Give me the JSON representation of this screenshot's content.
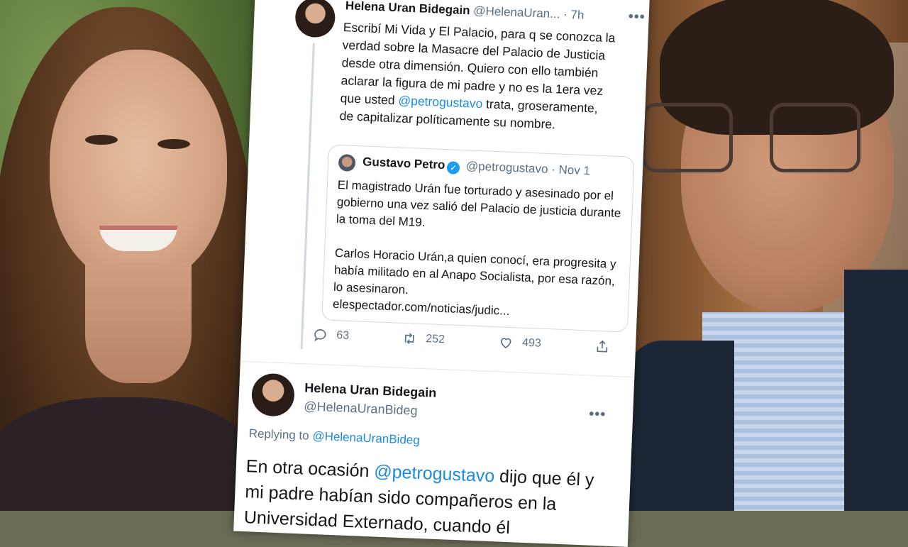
{
  "main_tweet": {
    "author_name": "Helena Uran Bidegain",
    "author_handle": "@HelenaUran...",
    "time": "· 7h",
    "text_lines": [
      "Escribí Mi Vida y El Palacio, para q se conozca la",
      "verdad sobre la Masacre del Palacio de Justicia",
      "desde otra dimensión. Quiero con ello también",
      "aclarar la figura de mi padre y no es la 1era vez",
      "que usted ",
      "@petrogustavo",
      " trata, groseramente,",
      "de capitalizar políticamente su nombre."
    ],
    "more": "•••"
  },
  "quoted_tweet": {
    "author_name": "Gustavo Petro",
    "author_handle": "@petrogustavo · Nov 1",
    "verified_mark": "✓",
    "paragraph_1": "El magistrado Urán fue torturado y asesinado por el gobierno una vez salió del Palacio de justicia durante la toma del M19.",
    "paragraph_2": "Carlos Horacio Urán,a quien conocí, era progresita y había militado en al Anapo Socialista, por esa razón, lo asesinaron.",
    "link": "elespectador.com/noticias/judic..."
  },
  "actions": {
    "replies": "63",
    "retweets": "252",
    "likes": "493"
  },
  "reply_tweet": {
    "author_name": "Helena Uran Bidegain",
    "author_handle": "@HelenaUranBideg",
    "more": "•••",
    "replying_label": "Replying to ",
    "replying_handle": "@HelenaUranBideg",
    "text_before": "En otra ocasión ",
    "text_mention": "@petrogustavo",
    "text_after": " dijo que él y mi padre habían sido compañeros en la Universidad Externado, cuando él"
  },
  "colors": {
    "link_blue": "#1b8be0",
    "secondary_text": "#5b7083",
    "verified_blue": "#1d9bf0"
  }
}
